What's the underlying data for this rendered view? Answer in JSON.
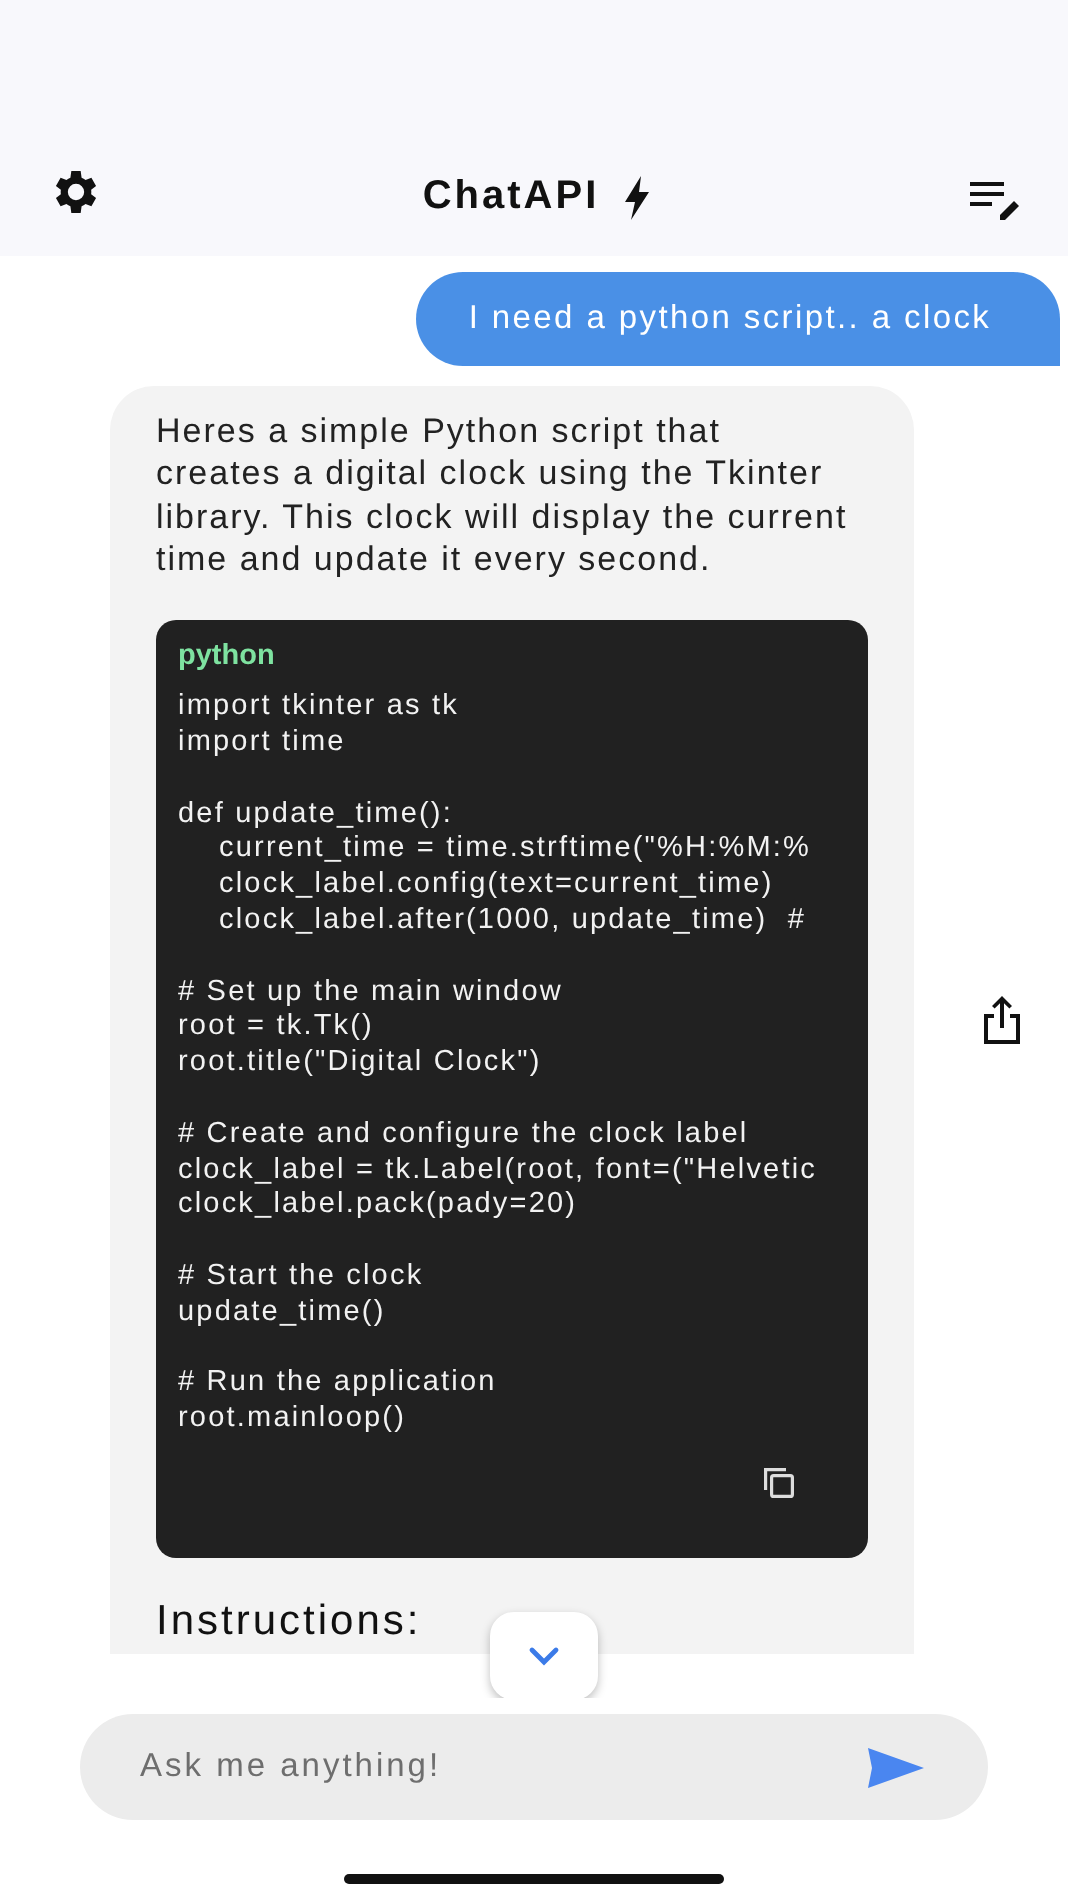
{
  "header": {
    "title": "ChatAPI"
  },
  "messages": [
    {
      "kind": "user",
      "text": "I need a python script.. a clock"
    },
    {
      "kind": "assistant",
      "text": "Heres a simple Python script that creates a digital clock using the Tkinter library. This clock will display the current time and update it every second.",
      "code": {
        "language": "python",
        "blocks": [
          [
            "import tkinter as tk",
            "import time"
          ],
          [
            "def update_time():",
            "    current_time = time.strftime(\"%H:%M:%",
            "    clock_label.config(text=current_time)",
            "    clock_label.after(1000, update_time)  #"
          ],
          [
            "# Set up the main window",
            "root = tk.Tk()",
            "root.title(\"Digital Clock\")"
          ],
          [
            "# Create and configure the clock label",
            "clock_label = tk.Label(root, font=(\"Helvetic",
            "clock_label.pack(pady=20)"
          ],
          [
            "# Start the clock",
            "update_time()"
          ],
          [
            "# Run the application",
            "root.mainloop()"
          ]
        ]
      },
      "heading": "Instructions:"
    }
  ],
  "composer": {
    "placeholder": "Ask me anything!"
  }
}
